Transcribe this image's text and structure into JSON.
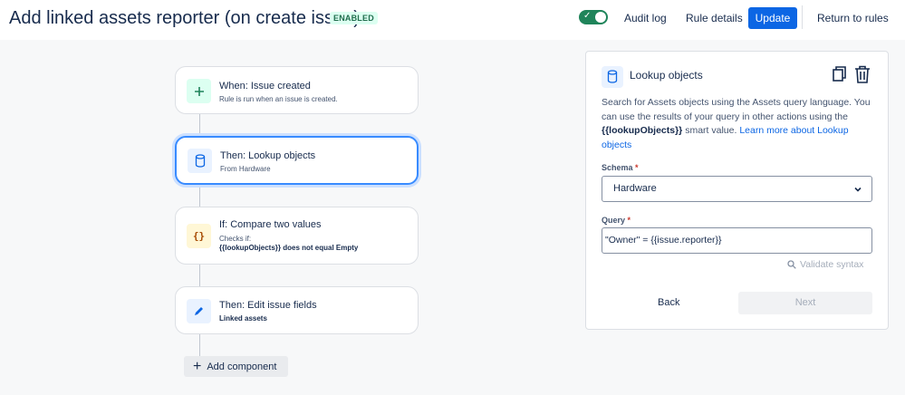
{
  "header": {
    "title": "Add linked assets reporter (on create issue)",
    "status": "ENABLED",
    "audit_log": "Audit log",
    "rule_details": "Rule details",
    "update": "Update",
    "return_to_rules": "Return to rules"
  },
  "flow": {
    "steps": [
      {
        "title": "When: Issue created",
        "subtitle": "Rule is run when an issue is created.",
        "icon": "plus-icon",
        "color": "#dcfff1"
      },
      {
        "title": "Then: Lookup objects",
        "subtitle": "From Hardware",
        "icon": "database-icon",
        "color": "#e9f2ff"
      },
      {
        "title": "If: Compare two values",
        "subtitle": "Checks if:",
        "detail": "{{lookupObjects}} does not equal Empty",
        "icon": "braces-icon",
        "color": "#fff7d6"
      },
      {
        "title": "Then: Edit issue fields",
        "subtitle": "Linked assets",
        "icon": "pencil-icon",
        "color": "#e9f2ff"
      }
    ],
    "add_component": "Add component"
  },
  "panel": {
    "title": "Lookup objects",
    "desc_1": "Search for Assets objects using the Assets query language. You can use the results of your query in other actions using the",
    "desc_smart": "{{lookupObjects}}",
    "desc_2": "smart value.",
    "desc_link": "Learn more about Lookup objects",
    "schema_label": "Schema",
    "schema_value": "Hardware",
    "query_label": "Query",
    "query_value": "\"Owner\" = {{issue.reporter}}",
    "validate": "Validate syntax",
    "back": "Back",
    "next": "Next"
  },
  "colors": {
    "accent": "#0c66e4",
    "enabled_green": "#1f845a"
  }
}
